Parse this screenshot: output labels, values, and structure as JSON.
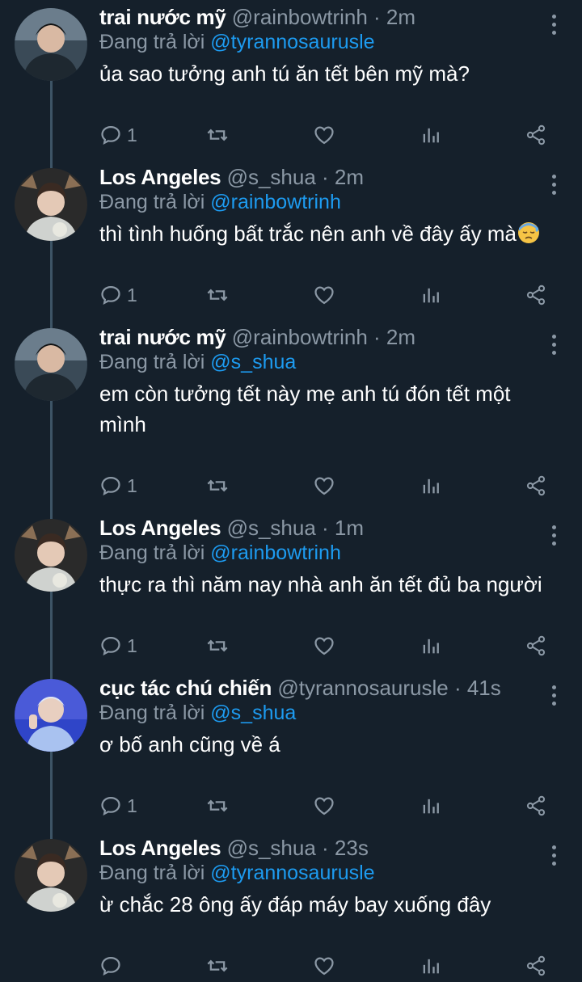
{
  "colors": {
    "background": "#15202b",
    "secondary_text": "#8b98a5",
    "link": "#1d9bf0",
    "thread_line": "#3d5466"
  },
  "tweets": [
    {
      "name": "trai nước mỹ",
      "handle": "@rainbowtrinh",
      "time": "2m",
      "replying_prefix": "Đang trả lời",
      "replying_to": "@tyrannosaurusle",
      "text": "ủa sao tưởng anh tú ăn tết bên mỹ mà?",
      "reply_count": "1",
      "emoji": "",
      "avatar": "avatar-trai-nuoc-my"
    },
    {
      "name": "Los Angeles",
      "handle": "@s_shua",
      "time": "2m",
      "replying_prefix": "Đang trả lời",
      "replying_to": "@rainbowtrinh",
      "text": "thì tình huống bất trắc nên anh về đây ấy mà",
      "reply_count": "1",
      "emoji": "downcast-face-with-sweat",
      "avatar": "avatar-los-angeles"
    },
    {
      "name": "trai nước mỹ",
      "handle": "@rainbowtrinh",
      "time": "2m",
      "replying_prefix": "Đang trả lời",
      "replying_to": "@s_shua",
      "text": "em còn tưởng tết này mẹ anh tú đón tết một mình",
      "reply_count": "1",
      "emoji": "",
      "avatar": "avatar-trai-nuoc-my"
    },
    {
      "name": "Los Angeles",
      "handle": "@s_shua",
      "time": "1m",
      "replying_prefix": "Đang trả lời",
      "replying_to": "@rainbowtrinh",
      "text": "thực ra thì năm nay nhà anh ăn tết đủ ba người",
      "reply_count": "1",
      "emoji": "",
      "avatar": "avatar-los-angeles"
    },
    {
      "name": "cục tác chú chiến",
      "handle": "@tyrannosaurusle",
      "time": "41s",
      "replying_prefix": "Đang trả lời",
      "replying_to": "@s_shua",
      "text": "ơ bố anh cũng về á",
      "reply_count": "1",
      "emoji": "",
      "avatar": "avatar-cuc-tac"
    },
    {
      "name": "Los Angeles",
      "handle": "@s_shua",
      "time": "23s",
      "replying_prefix": "Đang trả lời",
      "replying_to": "@tyrannosaurusle",
      "text": "ừ chắc 28 ông ấy đáp máy bay xuống đây",
      "reply_count": "",
      "emoji": "",
      "avatar": "avatar-los-angeles"
    }
  ],
  "icons": {
    "reply": "reply-icon",
    "retweet": "retweet-icon",
    "like": "heart-icon",
    "views": "views-icon",
    "share": "share-icon",
    "more": "more-icon"
  }
}
